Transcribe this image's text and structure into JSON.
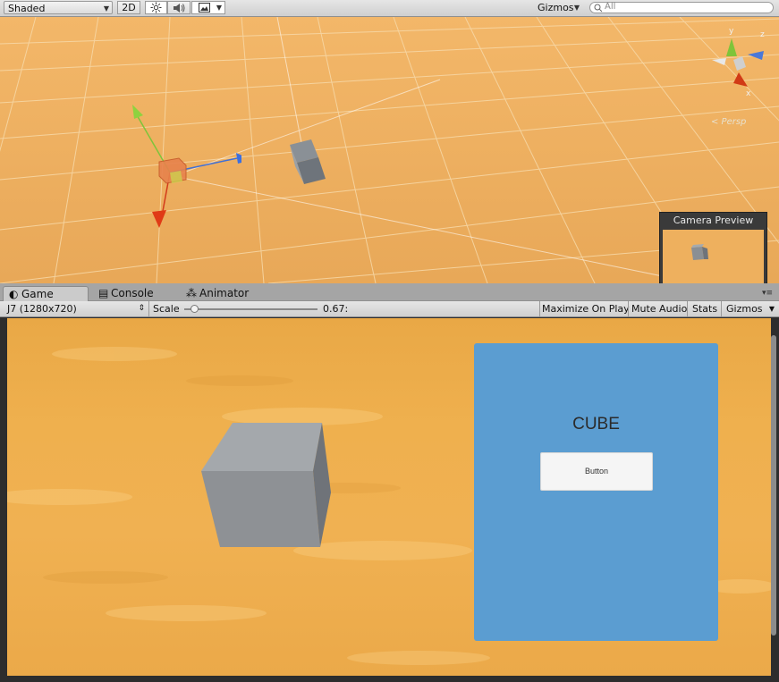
{
  "scene_toolbar": {
    "shading_mode": "Shaded",
    "mode_2d": "2D",
    "gizmos_label": "Gizmos",
    "search_placeholder": "All",
    "icons": [
      "sun-lighting-icon",
      "audio-speaker-icon",
      "image-effects-icon"
    ]
  },
  "scene": {
    "camera_preview_title": "Camera Preview",
    "projection_label": "< Persp",
    "axis_labels": {
      "y": "y",
      "x": "x",
      "z": "z"
    }
  },
  "tabs": [
    {
      "label": "Game",
      "icon": "game-controller-icon",
      "active": true
    },
    {
      "label": "Console",
      "icon": "console-icon",
      "active": false
    },
    {
      "label": "Animator",
      "icon": "animator-icon",
      "active": false
    }
  ],
  "game_toolbar": {
    "resolution": "J7 (1280x720)",
    "scale_label": "Scale",
    "scale_value": "0.67:",
    "scale_fraction": 0.05,
    "maximize_label": "Maximize On Play",
    "mute_label": "Mute Audio",
    "stats_label": "Stats",
    "gizmos_label": "Gizmos"
  },
  "game_view": {
    "panel_title": "CUBE",
    "button_label": "Button",
    "colors": {
      "panel": "#5b9dd1",
      "sand": "#f0b152",
      "cube": "#8e9195"
    }
  }
}
